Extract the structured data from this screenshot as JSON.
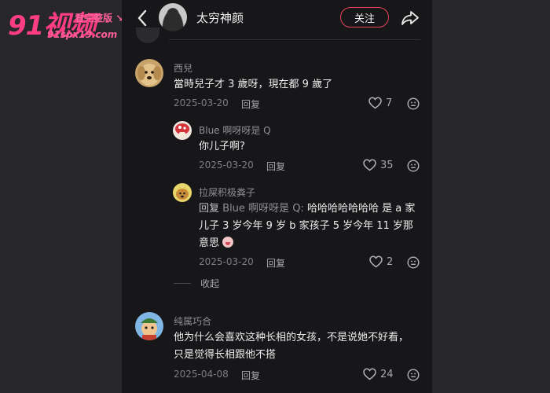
{
  "watermark": {
    "logo": "91视频",
    "tagline": "看完整版 ↘↘",
    "url": "91spx19.com"
  },
  "header": {
    "username": "太穷神颜",
    "follow_label": "关注"
  },
  "comments": [
    {
      "name": "西兒",
      "text": "當時兒子才 3 歲呀，現在都 9 歲了",
      "date": "2025-03-20",
      "reply_label": "回复",
      "likes": "7"
    },
    {
      "name": "Blue 啊呀呀是 Q",
      "text": "你儿子啊?",
      "date": "2025-03-20",
      "reply_label": "回复",
      "likes": "35"
    },
    {
      "name": "拉屎积极粪子",
      "reply_prefix": "回复",
      "reply_target": "Blue 啊呀呀是 Q:",
      "text": "哈哈哈哈哈哈哈 是 a 家儿子 3 岁今年 9 岁 b 家孩子 5 岁今年 11 岁那意思",
      "date": "2025-03-20",
      "reply_label": "回复",
      "likes": "2"
    },
    {
      "name": "纯属巧合",
      "text": "他为什么会喜欢这种长相的女孩，不是说她不好看，只是觉得长相跟他不搭",
      "date": "2025-04-08",
      "reply_label": "回复",
      "likes": "24"
    }
  ],
  "collapse_label": "收起",
  "icons": {
    "back": "chevron-left-icon",
    "share": "share-arrow-icon",
    "like": "heart-outline-icon",
    "dislike": "neutral-face-icon"
  }
}
